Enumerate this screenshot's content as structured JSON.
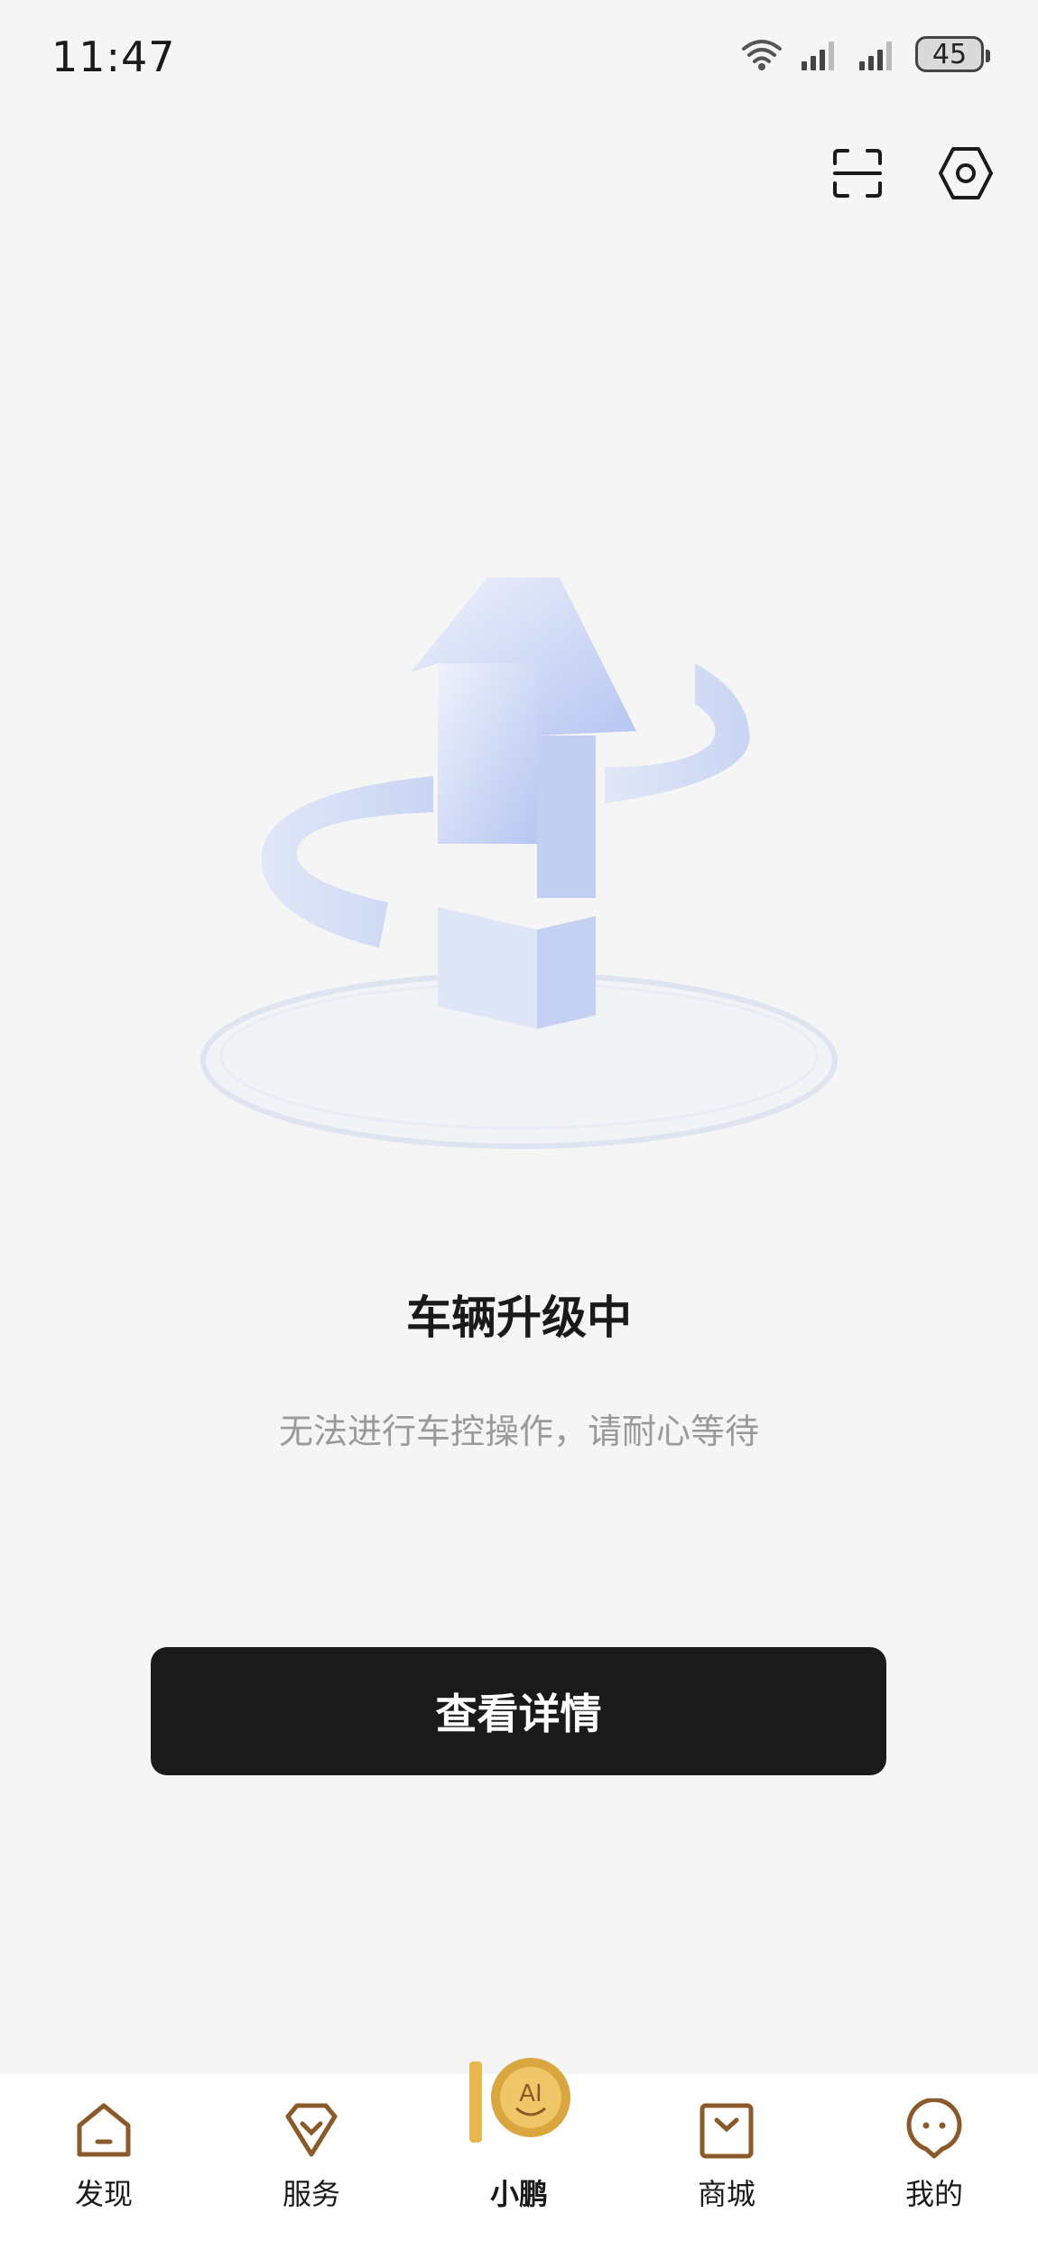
{
  "status_bar": {
    "time": "11:47",
    "battery": "45",
    "icons": [
      "wifi-icon",
      "signal-icon",
      "signal-icon",
      "battery-icon"
    ]
  },
  "top_actions": {
    "icons": [
      "scan-icon",
      "settings-icon"
    ]
  },
  "hero": {
    "illustration": "upgrade-arrow-illustration"
  },
  "main": {
    "title": "车辆升级中",
    "subtitle": "无法进行车控操作，请耐心等待",
    "details_button": "查看详情"
  },
  "bottom_nav": {
    "items": [
      {
        "label": "发现",
        "icon": "home-icon"
      },
      {
        "label": "服务",
        "icon": "service-icon"
      },
      {
        "label": "小鹏",
        "icon": "ai-assistant-icon",
        "active": true
      },
      {
        "label": "商城",
        "icon": "shop-bag-icon"
      },
      {
        "label": "我的",
        "icon": "profile-face-icon"
      }
    ]
  },
  "colors": {
    "background": "#f5f5f5",
    "button": "#1a1a1a",
    "nav_icon": "#8a5a2b",
    "ai_gold": "#d9a640"
  }
}
